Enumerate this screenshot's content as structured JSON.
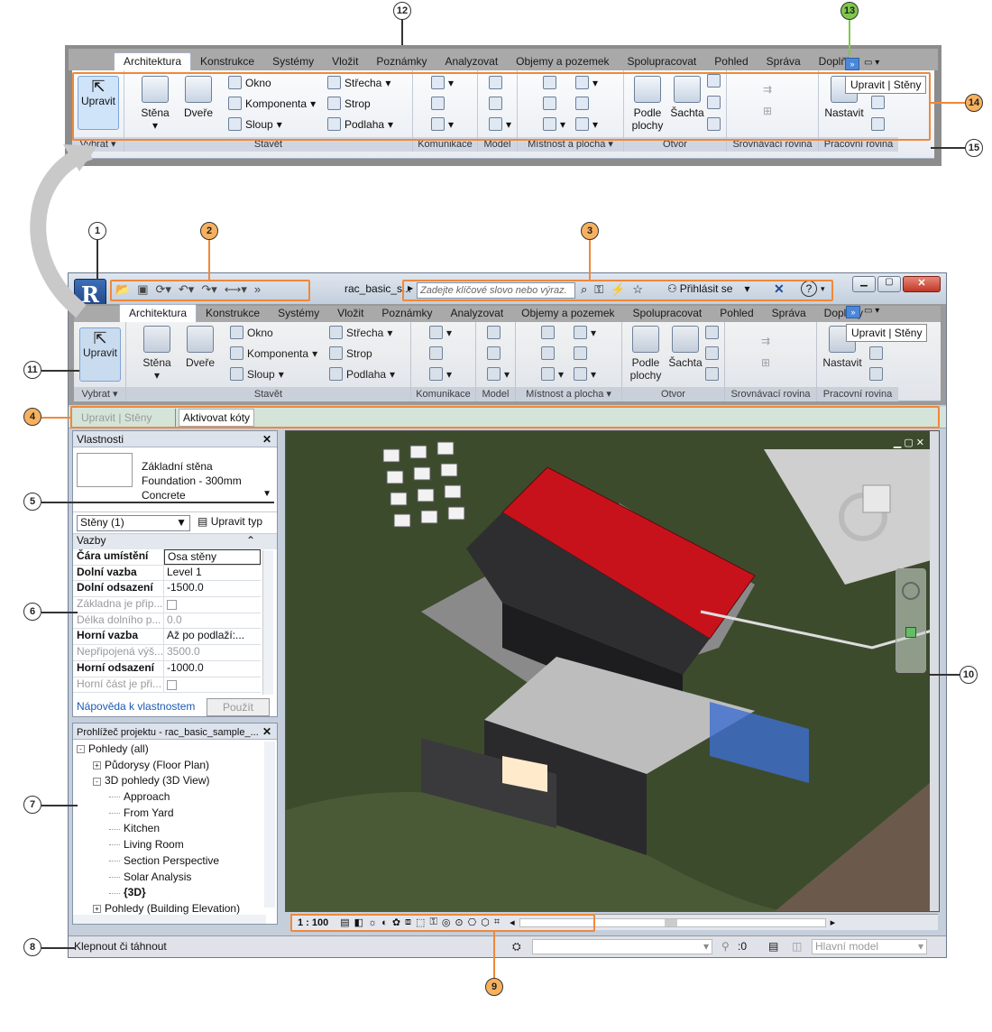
{
  "callouts": [
    "1",
    "2",
    "3",
    "4",
    "5",
    "6",
    "7",
    "8",
    "9",
    "10",
    "11",
    "12",
    "13",
    "14",
    "15"
  ],
  "title_bar": {
    "doc_title": "rac_basic_s...",
    "search_placeholder": "Zadejte klíčové slovo nebo výraz.",
    "sign_in": "Přihlásit se",
    "help": "?"
  },
  "tabs": [
    "Architektura",
    "Konstrukce",
    "Systémy",
    "Vložit",
    "Poznámky",
    "Analyzovat",
    "Objemy a pozemek",
    "Spolupracovat",
    "Pohled",
    "Správa",
    "Doplňky"
  ],
  "ribbon": {
    "select": "Upravit",
    "stena": "Stěna",
    "dvere": "Dveře",
    "okno": "Okno",
    "komponenta": "Komponenta",
    "sloup": "Sloup",
    "strecha": "Střecha",
    "strop": "Strop",
    "podlaha": "Podlaha",
    "podle_plochy": "Podle plochy",
    "sachta": "Šachta",
    "nastavit": "Nastavit",
    "panels": {
      "vybrat": "Vybrat",
      "stavet": "Stavět",
      "komunikace": "Komunikace",
      "model": "Model",
      "mistnost": "Místnost a plocha",
      "otvor": "Otvor",
      "srovnavaci": "Srovnávací rovina",
      "pracovni": "Pracovní rovina"
    },
    "tooltip": "Upravit | Stěny"
  },
  "options_bar": {
    "context": "Upravit | Stěny",
    "activate": "Aktivovat kóty"
  },
  "properties": {
    "title": "Vlastnosti",
    "type_lines": [
      "Základní stěna",
      "Foundation - 300mm",
      "Concrete"
    ],
    "selector": "Stěny (1)",
    "edit_type": "Upravit typ",
    "group": "Vazby",
    "rows": [
      {
        "k": "Čára umístění",
        "v": "Osa stěny",
        "dim": false
      },
      {
        "k": "Dolní vazba",
        "v": "Level 1",
        "dim": false
      },
      {
        "k": "Dolní odsazení",
        "v": "-1500.0",
        "dim": false
      },
      {
        "k": "Základna je přip...",
        "v": "",
        "dim": true
      },
      {
        "k": "Délka dolního p...",
        "v": "0.0",
        "dim": true
      },
      {
        "k": "Horní vazba",
        "v": "Až po podlaží:...",
        "dim": false
      },
      {
        "k": "Nepřipojená výš...",
        "v": "3500.0",
        "dim": true
      },
      {
        "k": "Horní odsazení",
        "v": "-1000.0",
        "dim": false
      },
      {
        "k": "Horní část je při...",
        "v": "",
        "dim": true
      }
    ],
    "help_link": "Nápověda k vlastnostem",
    "apply": "Použít"
  },
  "browser": {
    "title": "Prohlížeč projektu - rac_basic_sample_...",
    "items": [
      {
        "t": "Pohledy (all)",
        "lvl": 0,
        "toggle": "-"
      },
      {
        "t": "Půdorysy (Floor Plan)",
        "lvl": 1,
        "toggle": "+"
      },
      {
        "t": "3D pohledy (3D View)",
        "lvl": 1,
        "toggle": "-"
      },
      {
        "t": "Approach",
        "lvl": 2,
        "toggle": ""
      },
      {
        "t": "From Yard",
        "lvl": 2,
        "toggle": ""
      },
      {
        "t": "Kitchen",
        "lvl": 2,
        "toggle": ""
      },
      {
        "t": "Living Room",
        "lvl": 2,
        "toggle": ""
      },
      {
        "t": "Section Perspective",
        "lvl": 2,
        "toggle": ""
      },
      {
        "t": "Solar Analysis",
        "lvl": 2,
        "toggle": ""
      },
      {
        "t": "{3D}",
        "lvl": 2,
        "toggle": "",
        "bold": true
      },
      {
        "t": "Pohledy (Building Elevation)",
        "lvl": 1,
        "toggle": "+"
      }
    ]
  },
  "view_bar": {
    "scale": "1 : 100"
  },
  "status_bar": {
    "hint": "Klepnout či táhnout",
    "count": ":0",
    "model": "Hlavní model"
  },
  "colors": {
    "highlight": "#f0883a",
    "roof": "#c8121b",
    "terrain": "#3b4a2c"
  }
}
